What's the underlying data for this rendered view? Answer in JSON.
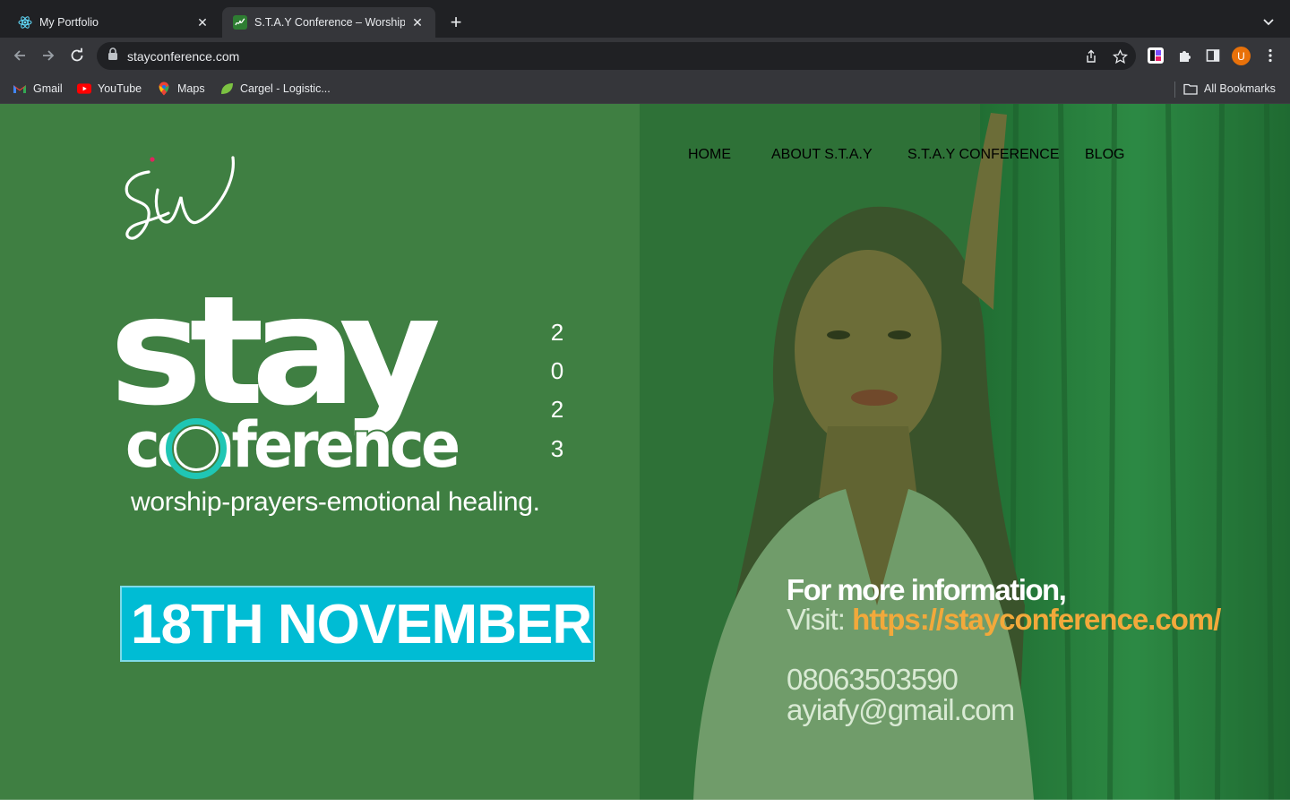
{
  "browser": {
    "tabs": [
      {
        "title": "My Portfolio",
        "icon": "react-icon",
        "active": false
      },
      {
        "title": "S.T.A.Y Conference – Worship",
        "icon": "sw-logo-icon",
        "active": true
      }
    ],
    "url": "stayconference.com",
    "avatar_letter": "U",
    "bookmarks": [
      {
        "label": "Gmail",
        "icon": "gmail-icon"
      },
      {
        "label": "YouTube",
        "icon": "youtube-icon"
      },
      {
        "label": "Maps",
        "icon": "maps-icon"
      },
      {
        "label": "Cargel - Logistic...",
        "icon": "cargel-icon"
      }
    ],
    "all_bookmarks_label": "All Bookmarks"
  },
  "site": {
    "nav": [
      {
        "label": "HOME"
      },
      {
        "label": "ABOUT S.T.A.Y"
      },
      {
        "label": "S.T.A.Y CONFERENCE"
      },
      {
        "label": "BLOG"
      }
    ],
    "logo_text": "sw",
    "hero": {
      "word1": "stay",
      "word2": "conference",
      "year_digits": [
        "2",
        "0",
        "2",
        "3"
      ],
      "tagline": "worship-prayers-emotional healing.",
      "date": "18TH NOVEMBER"
    },
    "info": {
      "line1": "For more information,",
      "visit_label": "Visit: ",
      "visit_link": "https://stayconference.com/",
      "phone": "08063503590",
      "email": "ayiafy@gmail.com"
    }
  },
  "colors": {
    "page_green": "#3f7f42",
    "accent_cyan": "#00bcd4",
    "link_orange": "#f2a93b",
    "ring_teal": "#1fc6b4"
  }
}
